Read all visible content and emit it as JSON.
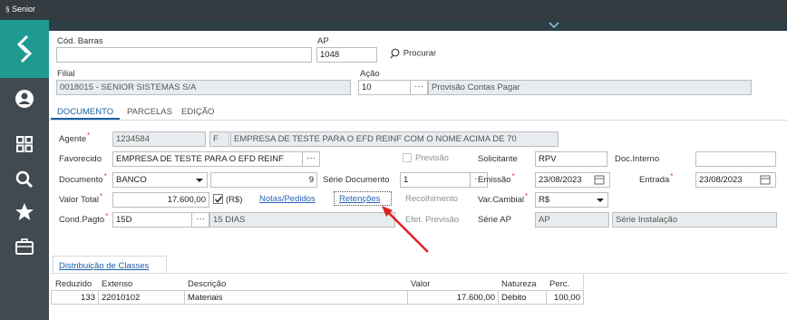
{
  "app": {
    "brand": "Senior"
  },
  "header_fields": {
    "cod_barras": {
      "label": "Cód. Barras",
      "value": ""
    },
    "ap": {
      "label": "AP",
      "value": "1048"
    },
    "procurar": "Procurar",
    "filial": {
      "label": "Filial",
      "value": "0018015 - SENIOR SISTEMAS S/A"
    },
    "acao": {
      "label": "Ação",
      "value": "10",
      "description": "Provisão Contas Pagar"
    }
  },
  "tabs": {
    "documento": "DOCUMENTO",
    "parcelas": "PARCELAS",
    "edicao": "EDIÇÃO"
  },
  "form": {
    "agente": {
      "label": "Agente",
      "code": "1234584",
      "type": "F",
      "name": "EMPRESA DE TESTE PARA O EFD REINF COM O NOME ACIMA DE 70"
    },
    "favorecido": {
      "label": "Favorecido",
      "value": "EMPRESA DE TESTE PARA O EFD REINF"
    },
    "previsao": {
      "label": "Previsão"
    },
    "solicitante": {
      "label": "Solicitante",
      "value": "RPV"
    },
    "doc_interno": {
      "label": "Doc.Interno",
      "value": ""
    },
    "documento": {
      "label": "Documento",
      "type": "BANCO",
      "number": "9"
    },
    "serie_documento": {
      "label": "Série Documento",
      "value": "1"
    },
    "emissao": {
      "label": "Emissão",
      "value": "23/08/2023"
    },
    "entrada": {
      "label": "Entrada",
      "value": "23/08/2023"
    },
    "valor_total": {
      "label": "Valor Total",
      "value": "17.600,00",
      "currency_label": "(R$)"
    },
    "notas_pedidos": "Notas/Pedidos",
    "retencoes": "Retenções",
    "recolhimento": "Recolhimento",
    "var_cambial": {
      "label": "Var.Cambial",
      "value": "R$"
    },
    "cond_pagto": {
      "label": "Cond.Pagto",
      "code": "15D",
      "description": "15 DIAS"
    },
    "efet_previsao": "Efet. Previsão",
    "serie_ap": {
      "label": "Série AP",
      "code": "AP",
      "description": "Série Instalação"
    }
  },
  "distribuicao": {
    "tab": "Distribuição de Classes",
    "columns": [
      "Reduzido",
      "Extenso",
      "Descrição",
      "Valor",
      "Natureza",
      "Perc."
    ],
    "rows": [
      {
        "reduzido": "133",
        "extenso": "22010102",
        "descricao": "Materiais",
        "valor": "17.600,00",
        "natureza": "Débito",
        "perc": "100,00"
      }
    ]
  },
  "colors": {
    "accent": "#1f9a92",
    "topbar": "#333a40",
    "rail": "#414a50",
    "link": "#2b62b8",
    "arrow": "#e02020"
  },
  "icons": [
    "user-icon",
    "grid-icon",
    "search-icon",
    "star-icon",
    "briefcase-icon"
  ]
}
